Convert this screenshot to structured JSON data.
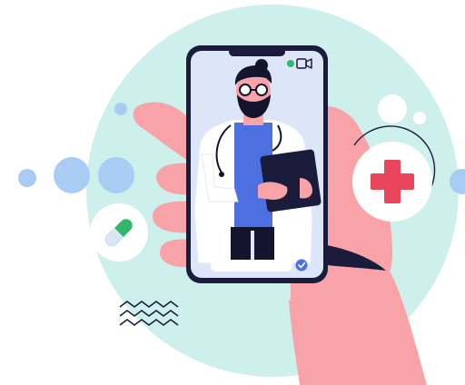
{
  "illustration": {
    "colors": {
      "background_circle": "#cdf0ed",
      "hand_skin": "#f7a3a8",
      "phone_frame": "#1b1c3c",
      "phone_screen": "#dde6f8",
      "doctor_shirt": "#4e6fe0",
      "doctor_coat": "#ffffff",
      "beard_hair": "#14142e",
      "medical_cross": "#e8455a",
      "dots_blue": "#a9ccf4",
      "pill_green": "#2fb86a",
      "live_indicator": "#2fb86a"
    },
    "icons": [
      "video-camera-icon",
      "check-badge-icon",
      "medical-cross-icon",
      "pill-icon",
      "tablet-icon",
      "stethoscope-icon"
    ]
  }
}
